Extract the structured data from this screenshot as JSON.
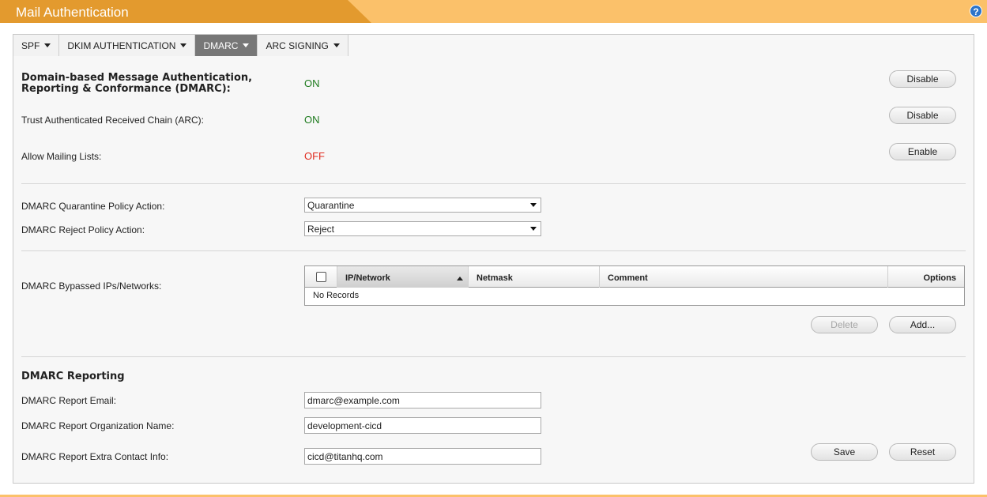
{
  "header": {
    "title": "Mail Authentication",
    "help_glyph": "?"
  },
  "tabs": [
    {
      "label": "SPF",
      "active": false
    },
    {
      "label": "DKIM AUTHENTICATION",
      "active": false
    },
    {
      "label": "DMARC",
      "active": true
    },
    {
      "label": "ARC SIGNING",
      "active": false
    }
  ],
  "settings": {
    "dmarc": {
      "label": "Domain-based Message Authentication, Reporting & Conformance (DMARC):",
      "status": "ON",
      "button": "Disable"
    },
    "arc": {
      "label": "Trust Authenticated Received Chain (ARC):",
      "status": "ON",
      "button": "Disable"
    },
    "mailing_lists": {
      "label": "Allow Mailing Lists:",
      "status": "OFF",
      "button": "Enable"
    }
  },
  "policies": {
    "quarantine": {
      "label": "DMARC Quarantine Policy Action:",
      "value": "Quarantine"
    },
    "reject": {
      "label": "DMARC Reject Policy Action:",
      "value": "Reject"
    }
  },
  "bypass": {
    "label": "DMARC Bypassed IPs/Networks:",
    "columns": [
      "IP/Network",
      "Netmask",
      "Comment",
      "Options"
    ],
    "empty_text": "No Records",
    "delete_button": "Delete",
    "add_button": "Add..."
  },
  "reporting": {
    "heading": "DMARC Reporting",
    "email_label": "DMARC Report Email:",
    "email_value": "dmarc@example.com",
    "org_label": "DMARC Report Organization Name:",
    "org_value": "development-cicd",
    "extra_label": "DMARC Report Extra Contact Info:",
    "extra_value": "cicd@titanhq.com",
    "save_button": "Save",
    "reset_button": "Reset"
  },
  "colors": {
    "header_dark": "#e39a2e",
    "header_light": "#fbc16a",
    "status_on": "#1e7b1e",
    "status_off": "#e02b1f",
    "active_tab": "#777777"
  }
}
